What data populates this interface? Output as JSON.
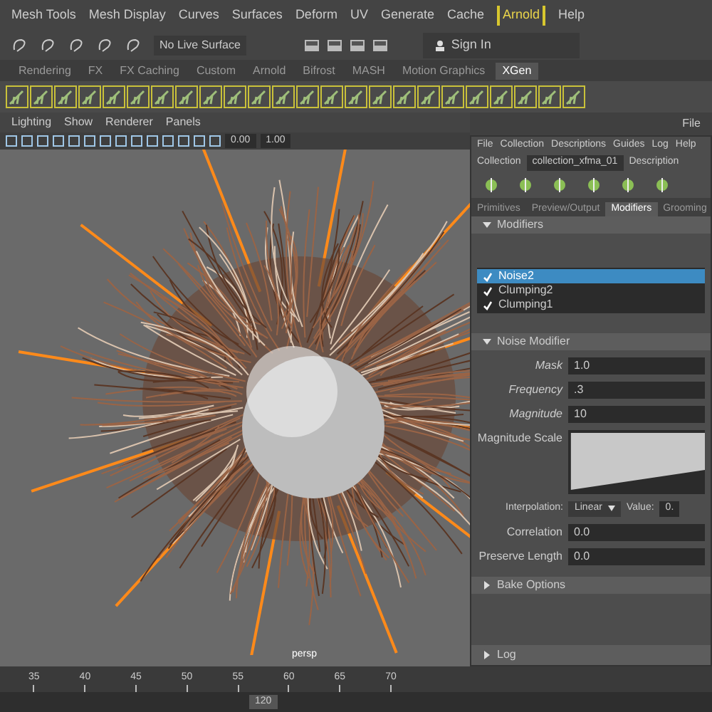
{
  "menu_bar": [
    {
      "label": "Mesh Tools",
      "selected": false
    },
    {
      "label": "Mesh Display",
      "selected": false
    },
    {
      "label": "Curves",
      "selected": false
    },
    {
      "label": "Surfaces",
      "selected": false
    },
    {
      "label": "Deform",
      "selected": false
    },
    {
      "label": "UV",
      "selected": false
    },
    {
      "label": "Generate",
      "selected": false
    },
    {
      "label": "Cache",
      "selected": false
    },
    {
      "label": "Arnold",
      "selected": true
    },
    {
      "label": "Help",
      "selected": false
    }
  ],
  "status_line": {
    "live_surface": "No Live Surface",
    "sign_in": "Sign In"
  },
  "shelf_tabs": [
    {
      "label": "Rendering",
      "selected": false
    },
    {
      "label": "FX",
      "selected": false
    },
    {
      "label": "FX Caching",
      "selected": false
    },
    {
      "label": "Custom",
      "selected": false
    },
    {
      "label": "Arnold",
      "selected": false
    },
    {
      "label": "Bifrost",
      "selected": false
    },
    {
      "label": "MASH",
      "selected": false
    },
    {
      "label": "Motion Graphics",
      "selected": false
    },
    {
      "label": "XGen",
      "selected": true
    }
  ],
  "viewport": {
    "menu": [
      "Lighting",
      "Show",
      "Renderer",
      "Panels"
    ],
    "exposure": "0.00",
    "gamma": "1.00",
    "camera_label": "persp"
  },
  "side_menu": {
    "label": "File"
  },
  "xgen_panel": {
    "menu": [
      "File",
      "Collection",
      "Descriptions",
      "Guides",
      "Log",
      "Help"
    ],
    "collection_label": "Collection",
    "collection": "collection_xfma_01",
    "description_label": "Description",
    "tabs": [
      {
        "label": "Primitives",
        "selected": false
      },
      {
        "label": "Preview/Output",
        "selected": false
      },
      {
        "label": "Modifiers",
        "selected": true
      },
      {
        "label": "Grooming",
        "selected": false
      }
    ],
    "modifiers_header": "Modifiers",
    "modifiers": [
      {
        "name": "Noise2",
        "checked": true,
        "selected": true
      },
      {
        "name": "Clumping2",
        "checked": true,
        "selected": false
      },
      {
        "name": "Clumping1",
        "checked": true,
        "selected": false
      }
    ],
    "noise_header": "Noise Modifier",
    "fields": [
      {
        "label": "Mask",
        "value": "1.0"
      },
      {
        "label": "Frequency",
        "value": ".3"
      },
      {
        "label": "Magnitude",
        "value": "10"
      }
    ],
    "magnitude_scale_label": "Magnitude Scale",
    "interpolation_label": "Interpolation:",
    "interpolation": "Linear",
    "value_label": "Value:",
    "value": "0.",
    "lower_fields": [
      {
        "label": "Correlation",
        "value": "0.0"
      },
      {
        "label": "Preserve Length",
        "value": "0.0"
      }
    ],
    "bake_options": {
      "label": "Bake Options",
      "expanded": false
    },
    "log": {
      "label": "Log",
      "expanded": false
    }
  },
  "timeline": {
    "ticks": [
      "35",
      "40",
      "45",
      "50",
      "55",
      "60",
      "65",
      "70"
    ],
    "end_frame": "120"
  }
}
